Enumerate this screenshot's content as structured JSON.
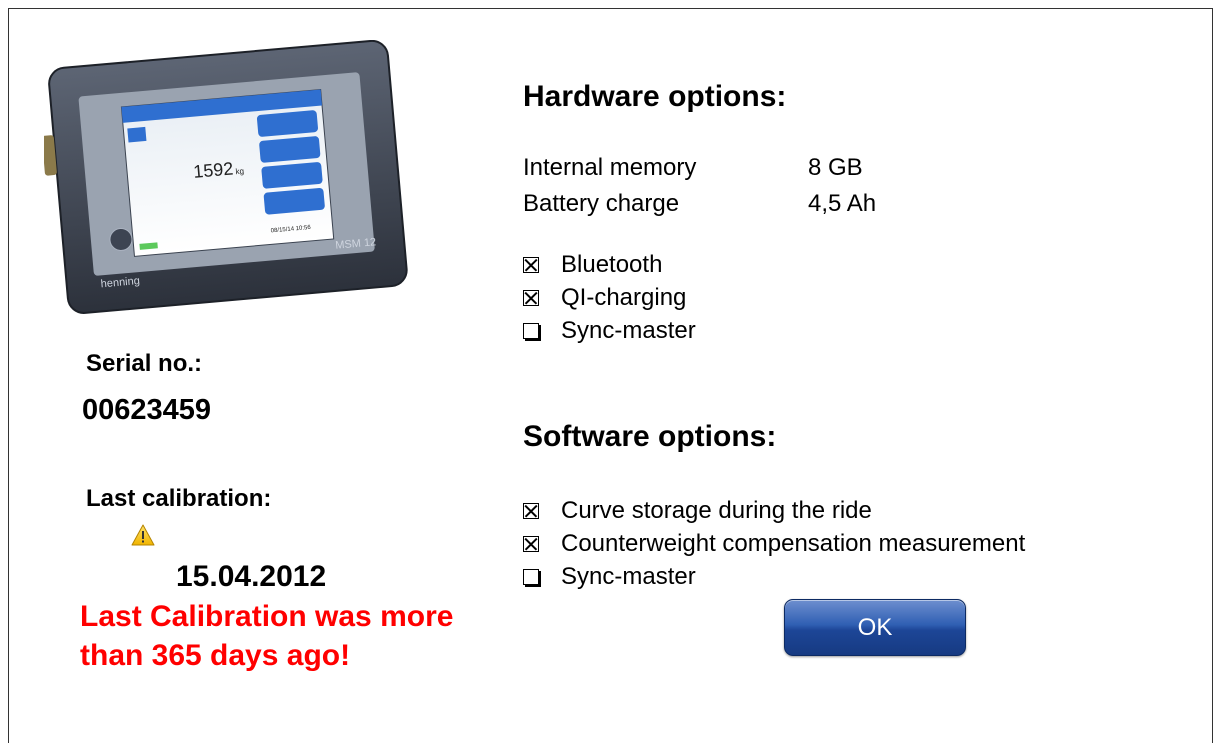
{
  "device": {
    "model_label": "MSM 12",
    "brand_label": "henning",
    "screen_value": "1592",
    "screen_unit": "kg",
    "screen_timestamp": "08/15/14 10:56"
  },
  "serial": {
    "label": "Serial no.:",
    "value": "00623459"
  },
  "calibration": {
    "label": "Last calibration:",
    "date": "15.04.2012",
    "warning_icon": "warning-triangle-icon",
    "warning_text": "Last Calibration was more than 365 days ago!",
    "warning_color": "#ff0000"
  },
  "hardware": {
    "title": "Hardware options:",
    "specs": [
      {
        "key": "Internal memory",
        "value": "8 GB"
      },
      {
        "key": "Battery charge",
        "value": "4,5 Ah"
      }
    ],
    "options": [
      {
        "label": "Bluetooth",
        "checked": true
      },
      {
        "label": "QI-charging",
        "checked": true
      },
      {
        "label": "Sync-master",
        "checked": false
      }
    ]
  },
  "software": {
    "title": "Software options:",
    "options": [
      {
        "label": "Curve storage during the ride",
        "checked": true
      },
      {
        "label": "Counterweight compensation measurement",
        "checked": true
      },
      {
        "label": "Sync-master",
        "checked": false
      }
    ]
  },
  "ok_button": {
    "label": "OK",
    "color": "#2f5fb3"
  }
}
